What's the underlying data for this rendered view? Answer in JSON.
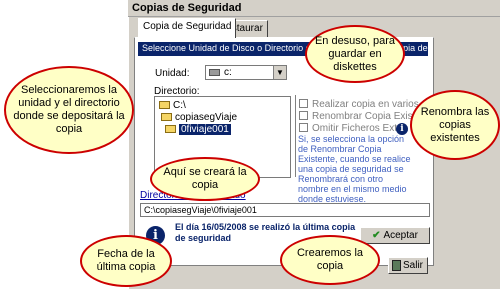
{
  "window": {
    "title": "Copias de Seguridad"
  },
  "tabs": [
    {
      "label": "Copia de Seguridad"
    },
    {
      "label": "Restaurar"
    }
  ],
  "heading": "Seleccione Unidad de Disco o Directorio donde se realizará la Copia de Seguridad",
  "drive": {
    "label": "Unidad:",
    "value": "c:"
  },
  "directory": {
    "label": "Directorio:",
    "items": [
      "C:\\",
      "copiasegViaje",
      "0fiviaje001"
    ]
  },
  "options": {
    "checks": [
      "Realizar copia en varios discos",
      "Renombrar Copia Existente",
      "Omitir Ficheros Extra."
    ],
    "info": "Si, se selecciona la opción de Renombrar Copia Existente, cuando se realice una copia de seguridad se Renombrará con otro nombre en el mismo medio donde estuviese."
  },
  "selected_dir": {
    "label": "Directorio Seleccionado",
    "value": "C:\\copiasegViaje\\0fiviaje001"
  },
  "last_backup": "El día 16/05/2008 se realizó la última copia de seguridad",
  "buttons": {
    "accept": "Aceptar",
    "exit": "Salir"
  },
  "callouts": {
    "select_drive": "Seleccionaremos la unidad y el directorio donde se depositará la copia",
    "deprecated": "En desuso, para guardar en diskettes",
    "rename": "Renombra las copias existentes",
    "created_here": "Aquí se creará la copia",
    "last_date": "Fecha de la última copia",
    "create": "Crearemos la copia"
  },
  "colors": {
    "callout_border": "#cc0000",
    "callout_fill": "#ffffc6",
    "heading": "#0a246a"
  }
}
